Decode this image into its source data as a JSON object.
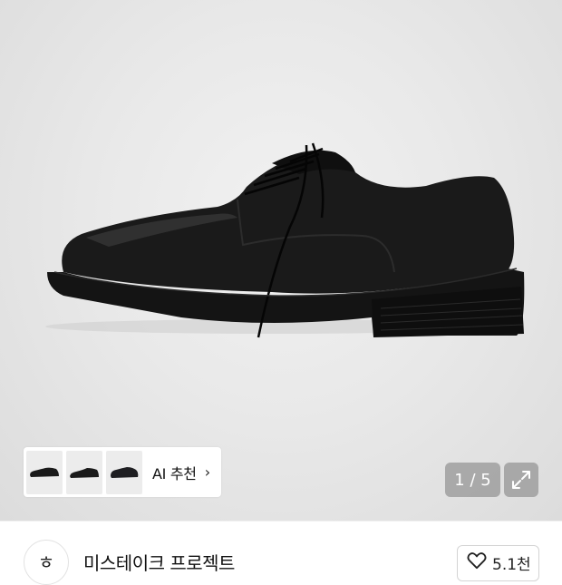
{
  "gallery": {
    "ai_label": "AI 추천",
    "chevron": "›",
    "counter": "1 / 5",
    "thumbnails": [
      "shoe-thumb-1",
      "shoe-thumb-2",
      "shoe-thumb-3"
    ]
  },
  "brand": {
    "logo_text": "ㅎ",
    "name": "미스테이크 프로젝트"
  },
  "like": {
    "icon": "heart-icon",
    "count": "5.1천"
  }
}
